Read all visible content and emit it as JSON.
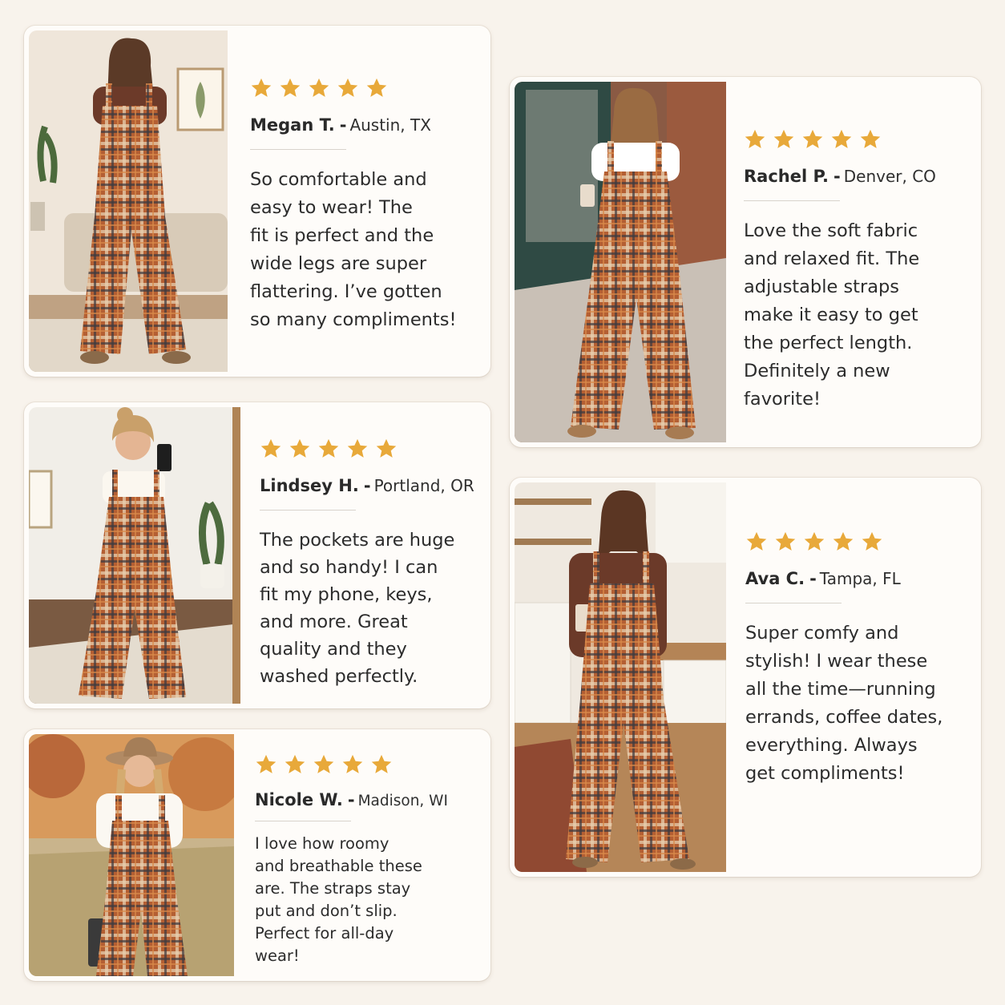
{
  "colors": {
    "background": "#f8f3ec",
    "card": "#fefcf9",
    "star": "#e8a93a",
    "plaid_base": "#b45f33",
    "plaid_dark": "#3c3a40",
    "plaid_light": "#e7cfae"
  },
  "reviews": [
    {
      "rating": 5,
      "name": "Megan T.",
      "location": "Austin, TX",
      "text": "So comfortable and\neasy to wear! The\nfit is perfect and the\nwide legs are super\nflattering. I’ve gotten\nso many compliments!",
      "photo": "woman-in-plaid-overalls-living-room"
    },
    {
      "rating": 5,
      "name": "Rachel P.",
      "location": "Denver, CO",
      "text": "Love the soft fabric\nand relaxed fit. The\nadjustable straps\nmake it easy to get\nthe perfect length.\nDefinitely a new\nfavorite!",
      "photo": "woman-in-plaid-overalls-street-with-coffee"
    },
    {
      "rating": 5,
      "name": "Lindsey H.",
      "location": "Portland, OR",
      "text": "The pockets are huge\nand so handy! I can\nfit my phone, keys,\nand more. Great\nquality and they\nwashed perfectly.",
      "photo": "woman-in-plaid-overalls-mirror-selfie"
    },
    {
      "rating": 5,
      "name": "Ava C.",
      "location": "Tampa, FL",
      "text": "Super comfy and\nstylish! I wear these\nall the time—running\nerrands, coffee dates,\neverything. Always\nget compliments!",
      "photo": "woman-in-plaid-overalls-kitchen-with-coffee"
    },
    {
      "rating": 5,
      "name": "Nicole W.",
      "location": "Madison, WI",
      "text": "I love how roomy\nand breathable these\nare. The straps stay\nput and don’t slip.\nPerfect for all-day\nwear!",
      "photo": "woman-in-plaid-overalls-autumn-field-with-hat"
    }
  ]
}
